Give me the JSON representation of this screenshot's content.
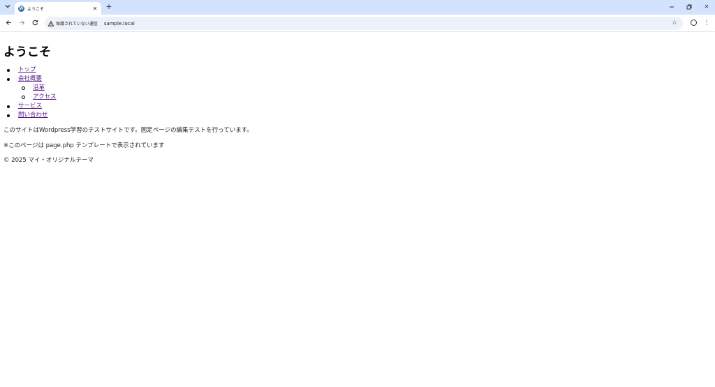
{
  "browser": {
    "tab_search_icon": "chevron-down-icon",
    "tab_title": "ようこそ",
    "tab_favicon_letter": "W",
    "new_tab_icon": "plus-icon",
    "window_controls": [
      "minimize-icon",
      "restore-icon",
      "close-icon"
    ],
    "security_label": "保護されていない通信",
    "url": "sample.local"
  },
  "page": {
    "title": "ようこそ",
    "menu": {
      "top": "トップ",
      "company": "会社概要",
      "company_children": {
        "history": "沿革",
        "access": "アクセス"
      },
      "service": "サービス",
      "contact": "問い合わせ"
    },
    "intro": "このサイトはWordpress学習のテストサイトです。固定ページの編集テストを行っています。",
    "template_note": "※このページは page.php テンプレートで表示されています",
    "footer": "© 2025 マイ・オリジナルテーマ"
  },
  "colors": {
    "tabstrip_bg": "#d3e3fd",
    "omnibox_bg": "#edf2fa",
    "visited_link": "#551a8b"
  }
}
